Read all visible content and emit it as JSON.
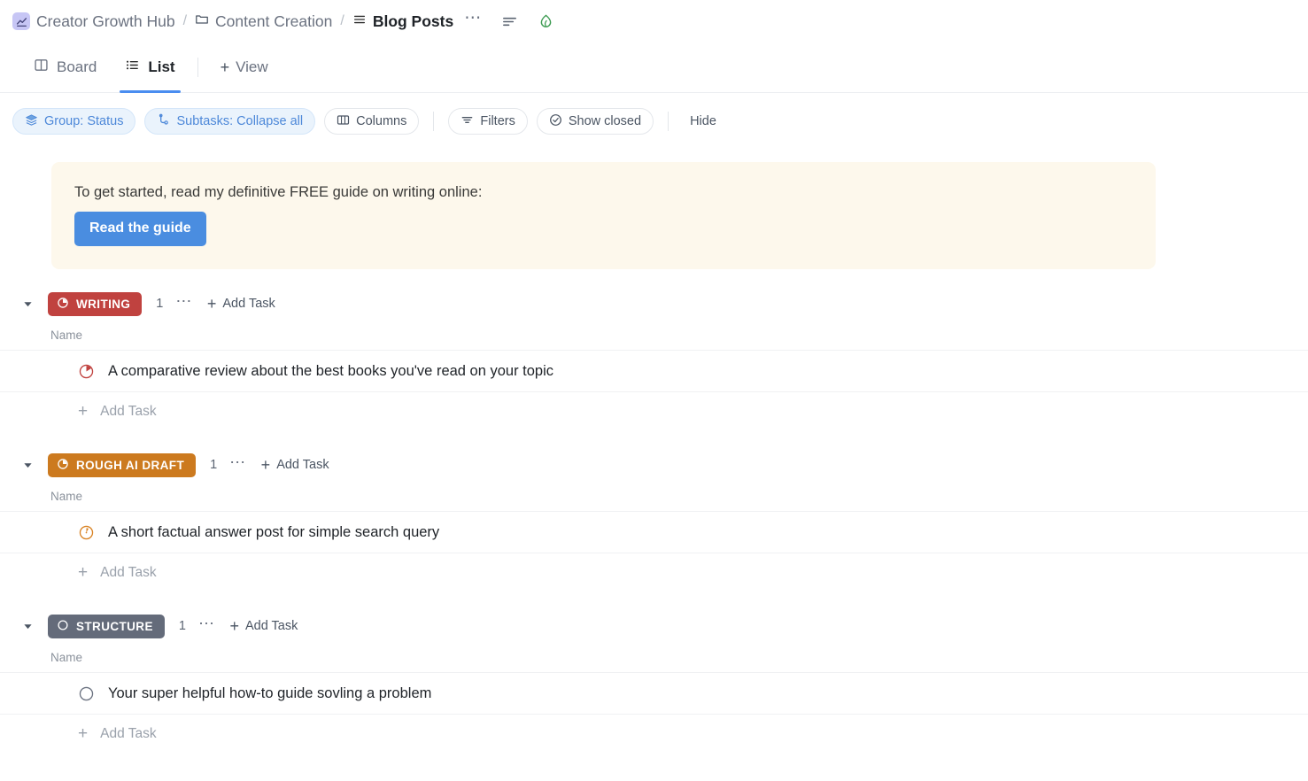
{
  "breadcrumb": {
    "workspace": "Creator Growth Hub",
    "folder": "Content Creation",
    "list": "Blog Posts",
    "separator": "/",
    "more_label": "⋯",
    "icons": {
      "workspace": "line-chart-icon",
      "folder": "folder-icon",
      "list": "list-lines-icon",
      "more": "ellipsis-icon",
      "sort": "sort-lines-icon",
      "leaf": "leaf-drop-icon"
    }
  },
  "tabs": [
    {
      "label": "Board",
      "icon": "board-icon",
      "active": false
    },
    {
      "label": "List",
      "icon": "list-icon",
      "active": true
    }
  ],
  "add_view": {
    "label": "View",
    "plus": "+"
  },
  "toolbar": {
    "group": {
      "label": "Group: Status",
      "icon": "layers-icon",
      "active": true
    },
    "subtasks": {
      "label": "Subtasks: Collapse all",
      "icon": "subtask-icon",
      "active": true
    },
    "columns": {
      "label": "Columns",
      "icon": "columns-icon",
      "active": false
    },
    "filters": {
      "label": "Filters",
      "icon": "filter-icon",
      "active": false
    },
    "show_closed": {
      "label": "Show closed",
      "icon": "check-circle-icon",
      "active": false
    },
    "hide": {
      "label": "Hide"
    }
  },
  "banner": {
    "text": "To get started, read my definitive FREE guide on writing online:",
    "button_label": "Read the guide",
    "bg_color": "#fdf8ec",
    "button_color": "#4a8de0"
  },
  "columns": {
    "name": "Name"
  },
  "add_task_label": "Add Task",
  "groups": [
    {
      "status": "WRITING",
      "color": "#c0423f",
      "status_icon": "clock-quarter-icon",
      "count": "1",
      "add_task": "Add Task",
      "tasks": [
        {
          "name": "A comparative review about the best books you've read on your topic",
          "status_icon": "clock-quarter-outline-icon",
          "icon_color": "#c0423f"
        }
      ]
    },
    {
      "status": "ROUGH AI DRAFT",
      "color": "#cc7a1f",
      "status_icon": "clock-quarter-icon",
      "count": "1",
      "add_task": "Add Task",
      "tasks": [
        {
          "name": "A short factual answer post for simple search query",
          "status_icon": "clock-small-outline-icon",
          "icon_color": "#d98324"
        }
      ]
    },
    {
      "status": "STRUCTURE",
      "color": "#646b7a",
      "status_icon": "circle-empty-icon",
      "count": "1",
      "add_task": "Add Task",
      "tasks": [
        {
          "name": "Your super helpful how-to guide sovling a problem",
          "status_icon": "circle-empty-outline-icon",
          "icon_color": "#6b7280"
        }
      ]
    }
  ]
}
